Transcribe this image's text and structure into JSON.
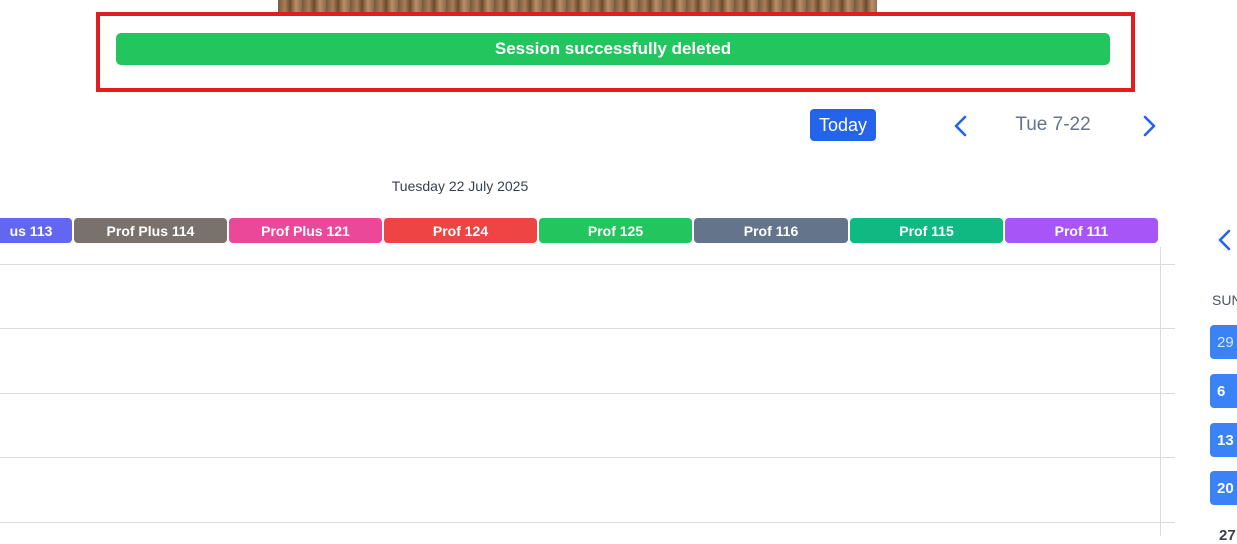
{
  "banner": {
    "toast_message": "Session successfully deleted",
    "toast_color": "#22c55e",
    "highlight_color": "#e11d1d"
  },
  "toolbar": {
    "today_label": "Today",
    "current_date": "Tue 7-22",
    "prev_icon": "chevron-left-icon",
    "next_icon": "chevron-right-icon",
    "accent": "#2563eb"
  },
  "day_view": {
    "title": "Tuesday 22 July 2025",
    "rooms": [
      {
        "label": "us 113",
        "color": "#6366f1"
      },
      {
        "label": "Prof Plus 114",
        "color": "#78716c"
      },
      {
        "label": "Prof Plus 121",
        "color": "#ec4899"
      },
      {
        "label": "Prof 124",
        "color": "#ef4444"
      },
      {
        "label": "Prof 125",
        "color": "#22c55e"
      },
      {
        "label": "Prof 116",
        "color": "#64748b"
      },
      {
        "label": "Prof 115",
        "color": "#10b981"
      },
      {
        "label": "Prof 111",
        "color": "#a855f7"
      }
    ]
  },
  "mini_calendar": {
    "prev_icon": "chevron-left-icon",
    "day_header": "SUN",
    "days": [
      "29",
      "6",
      "13",
      "20",
      "27"
    ]
  }
}
